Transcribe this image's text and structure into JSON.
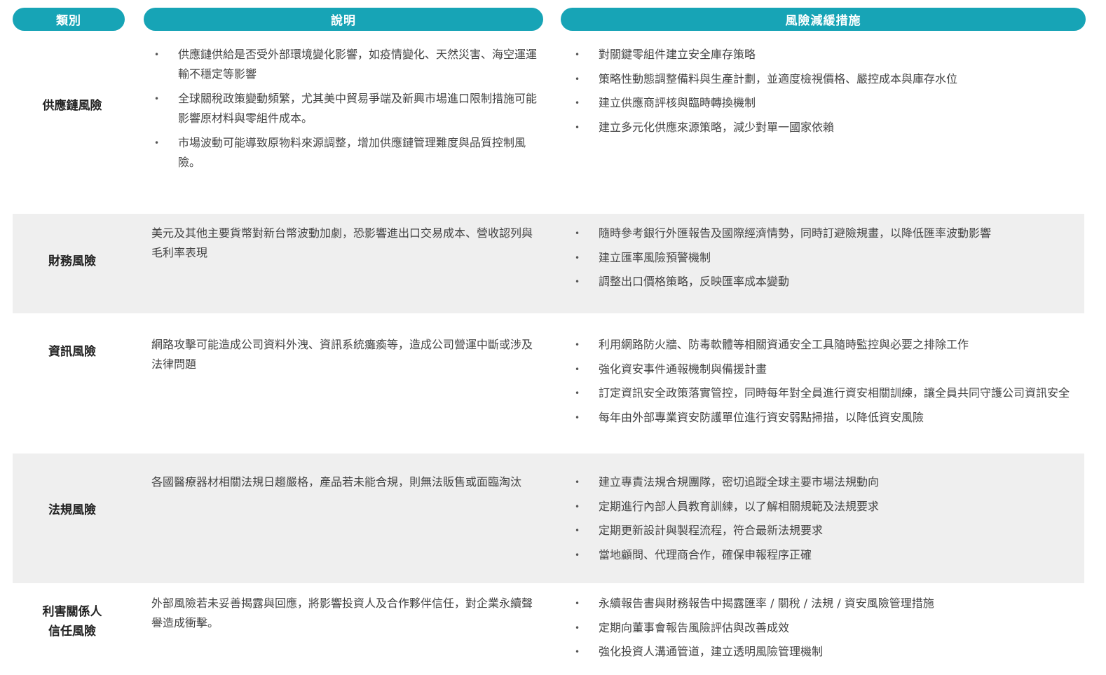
{
  "header": {
    "category": "類別",
    "description": "說明",
    "mitigation": "風險減緩措施"
  },
  "rows": [
    {
      "category": "供應鏈風險",
      "description": [
        "供應鏈供給是否受外部環境變化影響，如疫情變化、天然災害、海空運運輸不穩定等影響",
        "全球關稅政策變動頻繁，尤其美中貿易爭端及新興市場進口限制措施可能影響原材料與零組件成本。",
        "市場波動可能導致原物料來源調整，增加供應鏈管理難度與品質控制風險。"
      ],
      "mitigation": [
        "對關鍵零組件建立安全庫存策略",
        "策略性動態調整備料與生產計劃，並適度檢視價格、嚴控成本與庫存水位",
        "建立供應商評核與臨時轉換機制",
        "建立多元化供應來源策略，減少對單一國家依賴"
      ]
    },
    {
      "category": "財務風險",
      "description": "美元及其他主要貨幣對新台幣波動加劇，恐影響進出口交易成本、營收認列與毛利率表現",
      "mitigation": [
        "隨時參考銀行外匯報告及國際經濟情勢，同時訂避險規畫，以降低匯率波動影響",
        "建立匯率風險預警機制",
        "調整出口價格策略，反映匯率成本變動"
      ]
    },
    {
      "category": "資訊風險",
      "description": "網路攻擊可能造成公司資料外洩、資訊系統癱瘓等，造成公司營運中斷或涉及法律問題",
      "mitigation": [
        "利用網路防火牆、防毒軟體等相關資通安全工具隨時監控與必要之排除工作",
        "強化資安事件通報機制與備援計畫",
        "訂定資訊安全政策落實管控，同時每年對全員進行資安相關訓練，讓全員共同守護公司資訊安全",
        "每年由外部專業資安防護單位進行資安弱點掃描，以降低資安風險"
      ]
    },
    {
      "category": "法規風險",
      "description": "各國醫療器材相關法規日趨嚴格，產品若未能合規，則無法販售或面臨淘汰",
      "mitigation": [
        "建立專責法規合規團隊，密切追蹤全球主要市場法規動向",
        "定期進行內部人員教育訓練，以了解相關規範及法規要求",
        "定期更新設計與製程流程，符合最新法規要求",
        "當地顧問、代理商合作，確保申報程序正確"
      ]
    },
    {
      "category_line1": "利害關係人",
      "category_line2": "信任風險",
      "description": "外部風險若未妥善揭露與回應，將影響投資人及合作夥伴信任，對企業永續聲譽造成衝擊。",
      "mitigation": [
        "永續報告書與財務報告中揭露匯率 / 關稅 / 法規 / 資安風險管理措施",
        "定期向董事會報告風險評估與改善成效",
        "強化投資人溝通管道，建立透明風險管理機制"
      ]
    }
  ],
  "colors": {
    "header_bg": "#17a4b6",
    "header_text": "#ffffff",
    "row_shade": "#efefef",
    "body_text": "#444444"
  }
}
